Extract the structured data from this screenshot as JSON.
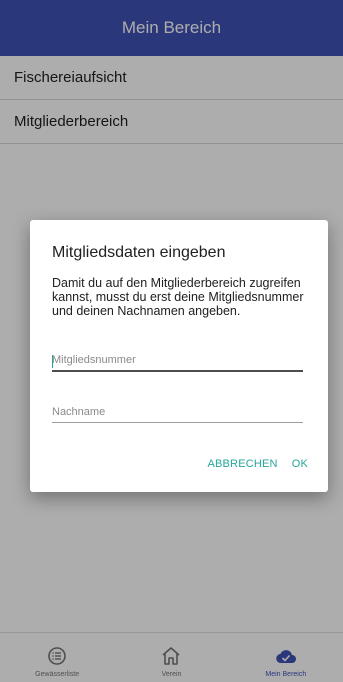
{
  "appbar": {
    "title": "Mein Bereich"
  },
  "list": {
    "items": [
      {
        "label": "Fischereiaufsicht"
      },
      {
        "label": "Mitgliederbereich"
      }
    ]
  },
  "dialog": {
    "title": "Mitgliedsdaten eingeben",
    "message": "Damit du auf den Mitgliederbereich zugreifen kannst, musst du erst deine Mitgliedsnummer und deinen Nachnamen angeben.",
    "member_number": {
      "value": "",
      "placeholder": "Mitgliedsnummer"
    },
    "last_name": {
      "value": "",
      "placeholder": "Nachname"
    },
    "cancel_label": "ABBRECHEN",
    "ok_label": "OK"
  },
  "bottom_nav": {
    "items": [
      {
        "label": "Gewässerliste",
        "icon": "list-circle-icon",
        "active": false
      },
      {
        "label": "Verein",
        "icon": "home-icon",
        "active": false
      },
      {
        "label": "Mein Bereich",
        "icon": "cloud-check-icon",
        "active": true
      }
    ]
  },
  "colors": {
    "primary": "#3f51b5",
    "accent": "#26a69a"
  }
}
